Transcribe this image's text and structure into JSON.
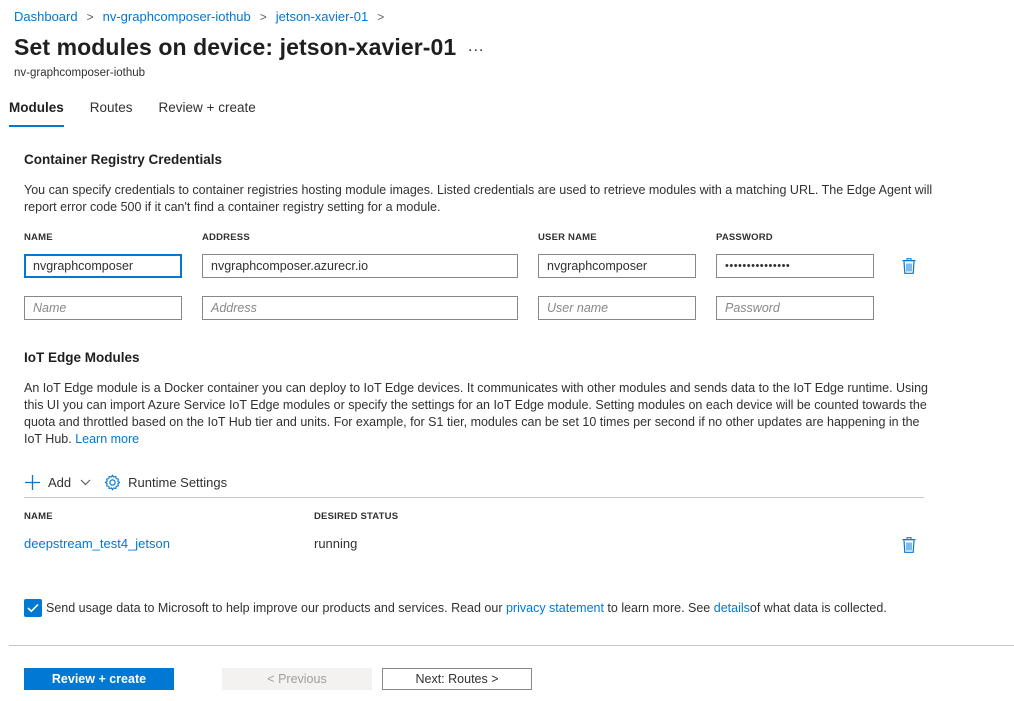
{
  "breadcrumb": {
    "items": [
      "Dashboard",
      "nv-graphcomposer-iothub",
      "jetson-xavier-01"
    ],
    "separator": ">"
  },
  "header": {
    "title": "Set modules on device: jetson-xavier-01",
    "more": "...",
    "subtitle": "nv-graphcomposer-iothub"
  },
  "tabs": [
    {
      "label": "Modules",
      "active": true
    },
    {
      "label": "Routes",
      "active": false
    },
    {
      "label": "Review + create",
      "active": false
    }
  ],
  "registry": {
    "title": "Container Registry Credentials",
    "description": "You can specify credentials to container registries hosting module images. Listed credentials are used to retrieve modules with a matching URL. The Edge Agent will report error code 500 if it can't find a container registry setting for a module.",
    "columns": {
      "name": "NAME",
      "address": "ADDRESS",
      "username": "USER NAME",
      "password": "PASSWORD"
    },
    "row": {
      "name": "nvgraphcomposer",
      "address": "nvgraphcomposer.azurecr.io",
      "username": "nvgraphcomposer",
      "password": "•••••••••••••••"
    },
    "placeholders": {
      "name": "Name",
      "address": "Address",
      "username": "User name",
      "password": "Password"
    }
  },
  "modules": {
    "title": "IoT Edge Modules",
    "description": "An IoT Edge module is a Docker container you can deploy to IoT Edge devices. It communicates with other modules and sends data to the IoT Edge runtime. Using this UI you can import Azure Service IoT Edge modules or specify the settings for an IoT Edge module. Setting modules on each device will be counted towards the quota and throttled based on the IoT Hub tier and units. For example, for S1 tier, modules can be set 10 times per second if no other updates are happening in the IoT Hub.",
    "learn_more": "Learn more",
    "toolbar": {
      "add": "Add",
      "runtime_settings": "Runtime Settings"
    },
    "columns": {
      "name": "NAME",
      "status": "DESIRED STATUS"
    },
    "rows": [
      {
        "name": "deepstream_test4_jetson",
        "status": "running"
      }
    ]
  },
  "consent": {
    "checked": true,
    "text_before": "Send usage data to Microsoft to help improve our products and services. Read our ",
    "privacy_link": "privacy statement",
    "text_middle": " to learn more. See",
    "details_link": "details",
    "text_after": "of what data is collected."
  },
  "footer": {
    "review_create": "Review + create",
    "previous": "< Previous",
    "next": "Next: Routes >"
  },
  "colors": {
    "accent": "#0078d4",
    "text": "#323130",
    "border": "#8a8886"
  }
}
